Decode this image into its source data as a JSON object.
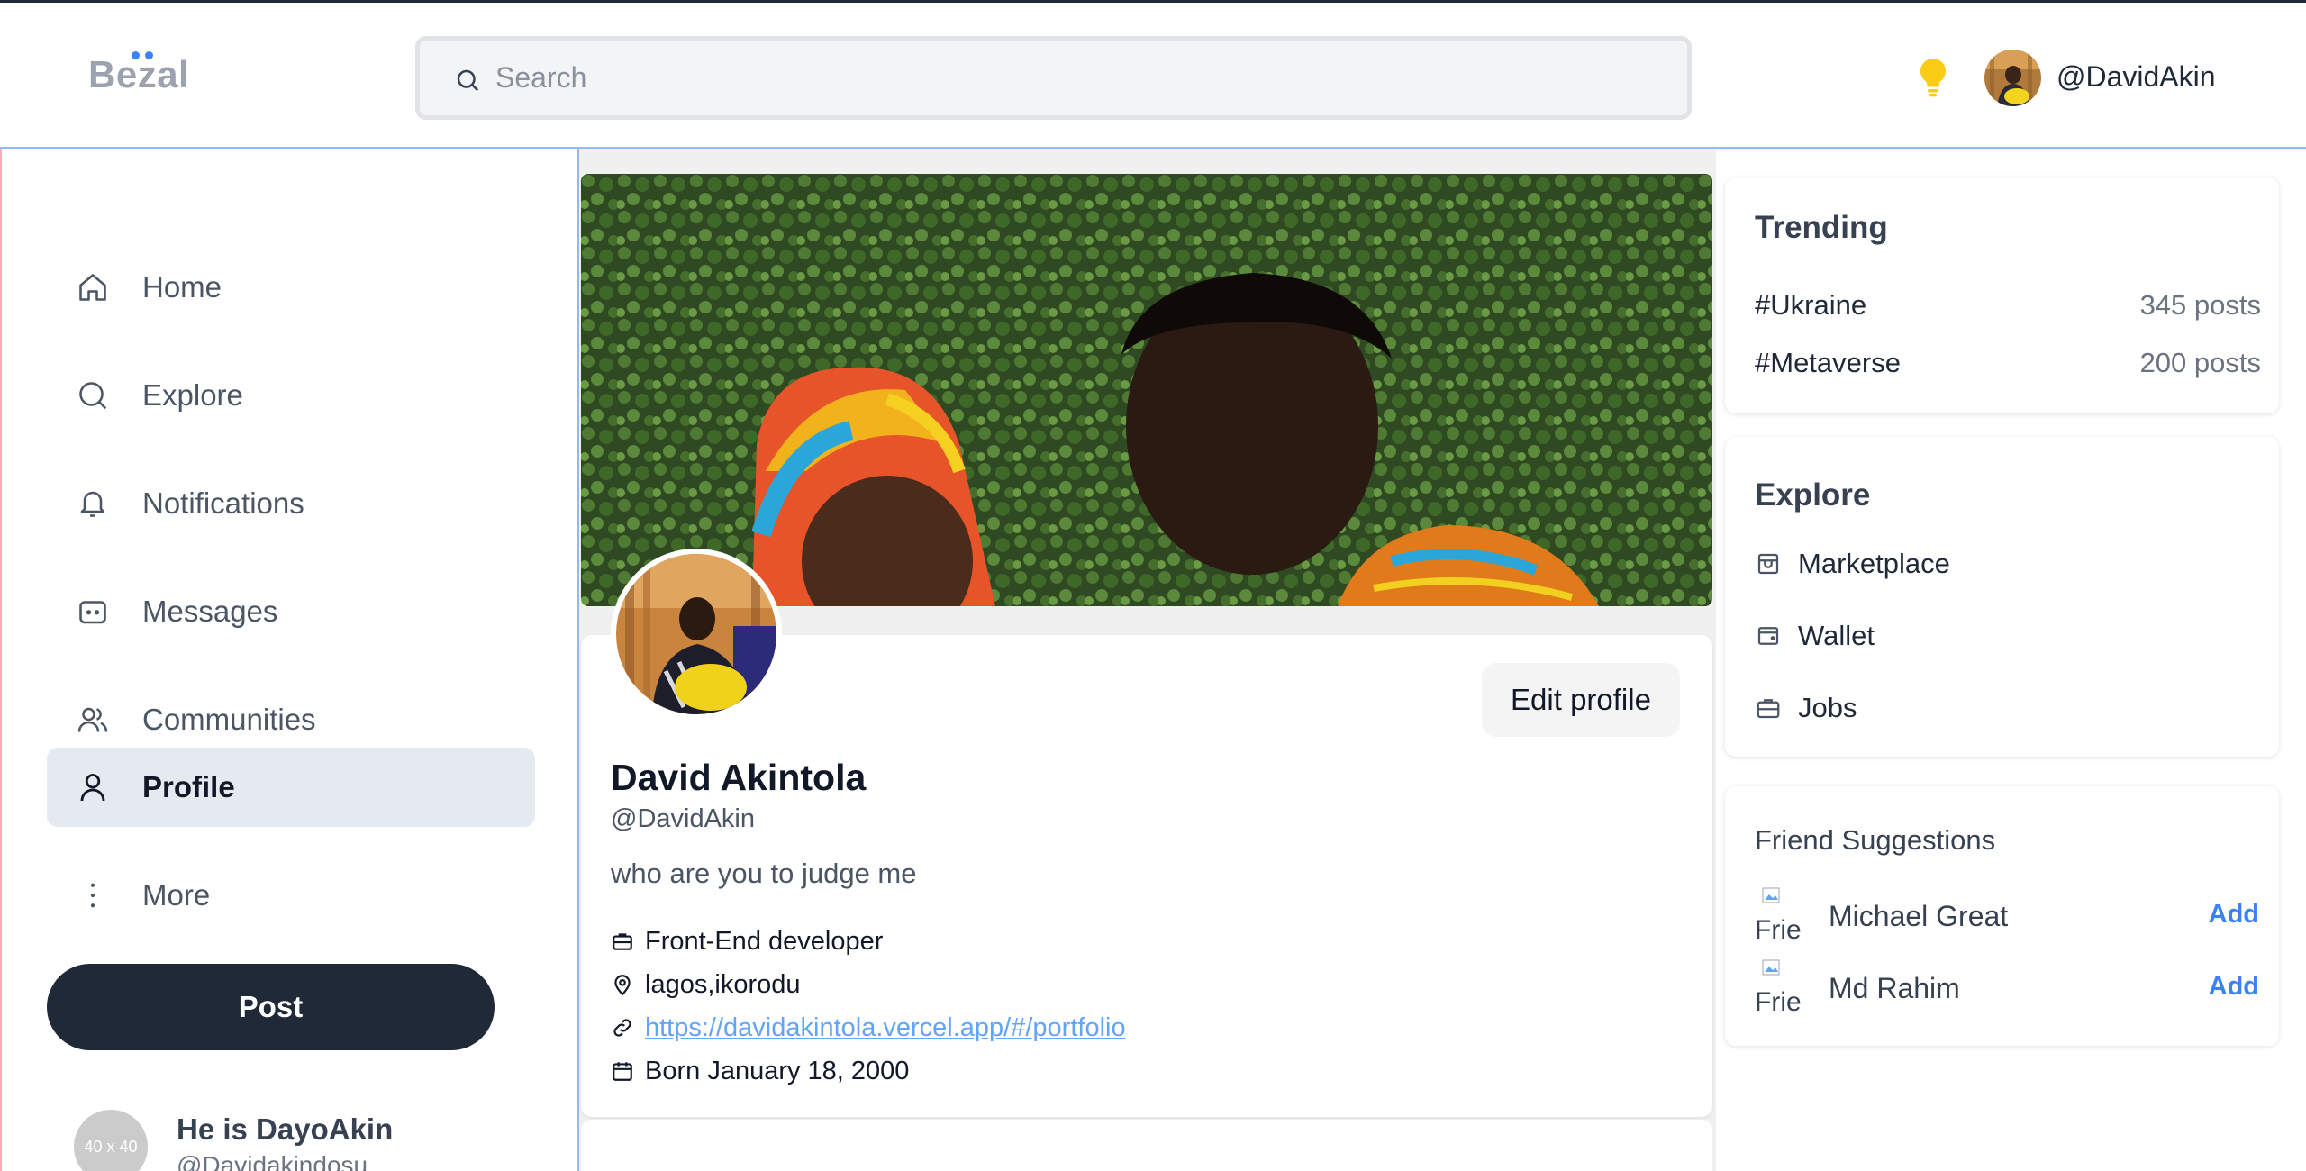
{
  "header": {
    "logo": "Bezal",
    "search_placeholder": "Search",
    "username": "@DavidAkin",
    "icons": [
      "search-icon",
      "lightbulb-icon"
    ]
  },
  "sidebar": {
    "items": [
      {
        "label": "Home",
        "icon": "home-icon"
      },
      {
        "label": "Explore",
        "icon": "search-icon"
      },
      {
        "label": "Notifications",
        "icon": "bell-icon"
      },
      {
        "label": "Messages",
        "icon": "message-icon"
      },
      {
        "label": "Communities",
        "icon": "users-icon"
      },
      {
        "label": "Profile",
        "icon": "user-icon",
        "active": true
      },
      {
        "label": "More",
        "icon": "more-vertical-icon"
      }
    ],
    "post_label": "Post",
    "user": {
      "avatar_placeholder": "40 x 40",
      "name": "He is DayoAkin",
      "handle": "@Davidakindosu"
    }
  },
  "profile": {
    "edit_label": "Edit profile",
    "name": "David Akintola",
    "handle": "@DavidAkin",
    "bio": "who are you to judge me",
    "occupation": "Front-End developer",
    "location": "lagos,ikorodu",
    "website": "https://davidakintola.vercel.app/#/portfolio",
    "born": "Born January 18, 2000"
  },
  "trending": {
    "title": "Trending",
    "items": [
      {
        "tag": "#Ukraine",
        "count": "345 posts"
      },
      {
        "tag": "#Metaverse",
        "count": "200 posts"
      }
    ]
  },
  "explore": {
    "title": "Explore",
    "items": [
      {
        "label": "Marketplace",
        "icon": "store-icon"
      },
      {
        "label": "Wallet",
        "icon": "wallet-icon"
      },
      {
        "label": "Jobs",
        "icon": "briefcase-icon"
      }
    ]
  },
  "friend_suggestions": {
    "title": "Friend Suggestions",
    "broken_image_alt": "Frie",
    "add_label": "Add",
    "items": [
      {
        "name": "Michael Great"
      },
      {
        "name": "Md Rahim"
      }
    ]
  },
  "colors": {
    "accent": "#3b82f6",
    "dark": "#1f2937",
    "active_nav": "#e5e9f0",
    "link": "#60a5fa",
    "bulb": "#facc15"
  }
}
